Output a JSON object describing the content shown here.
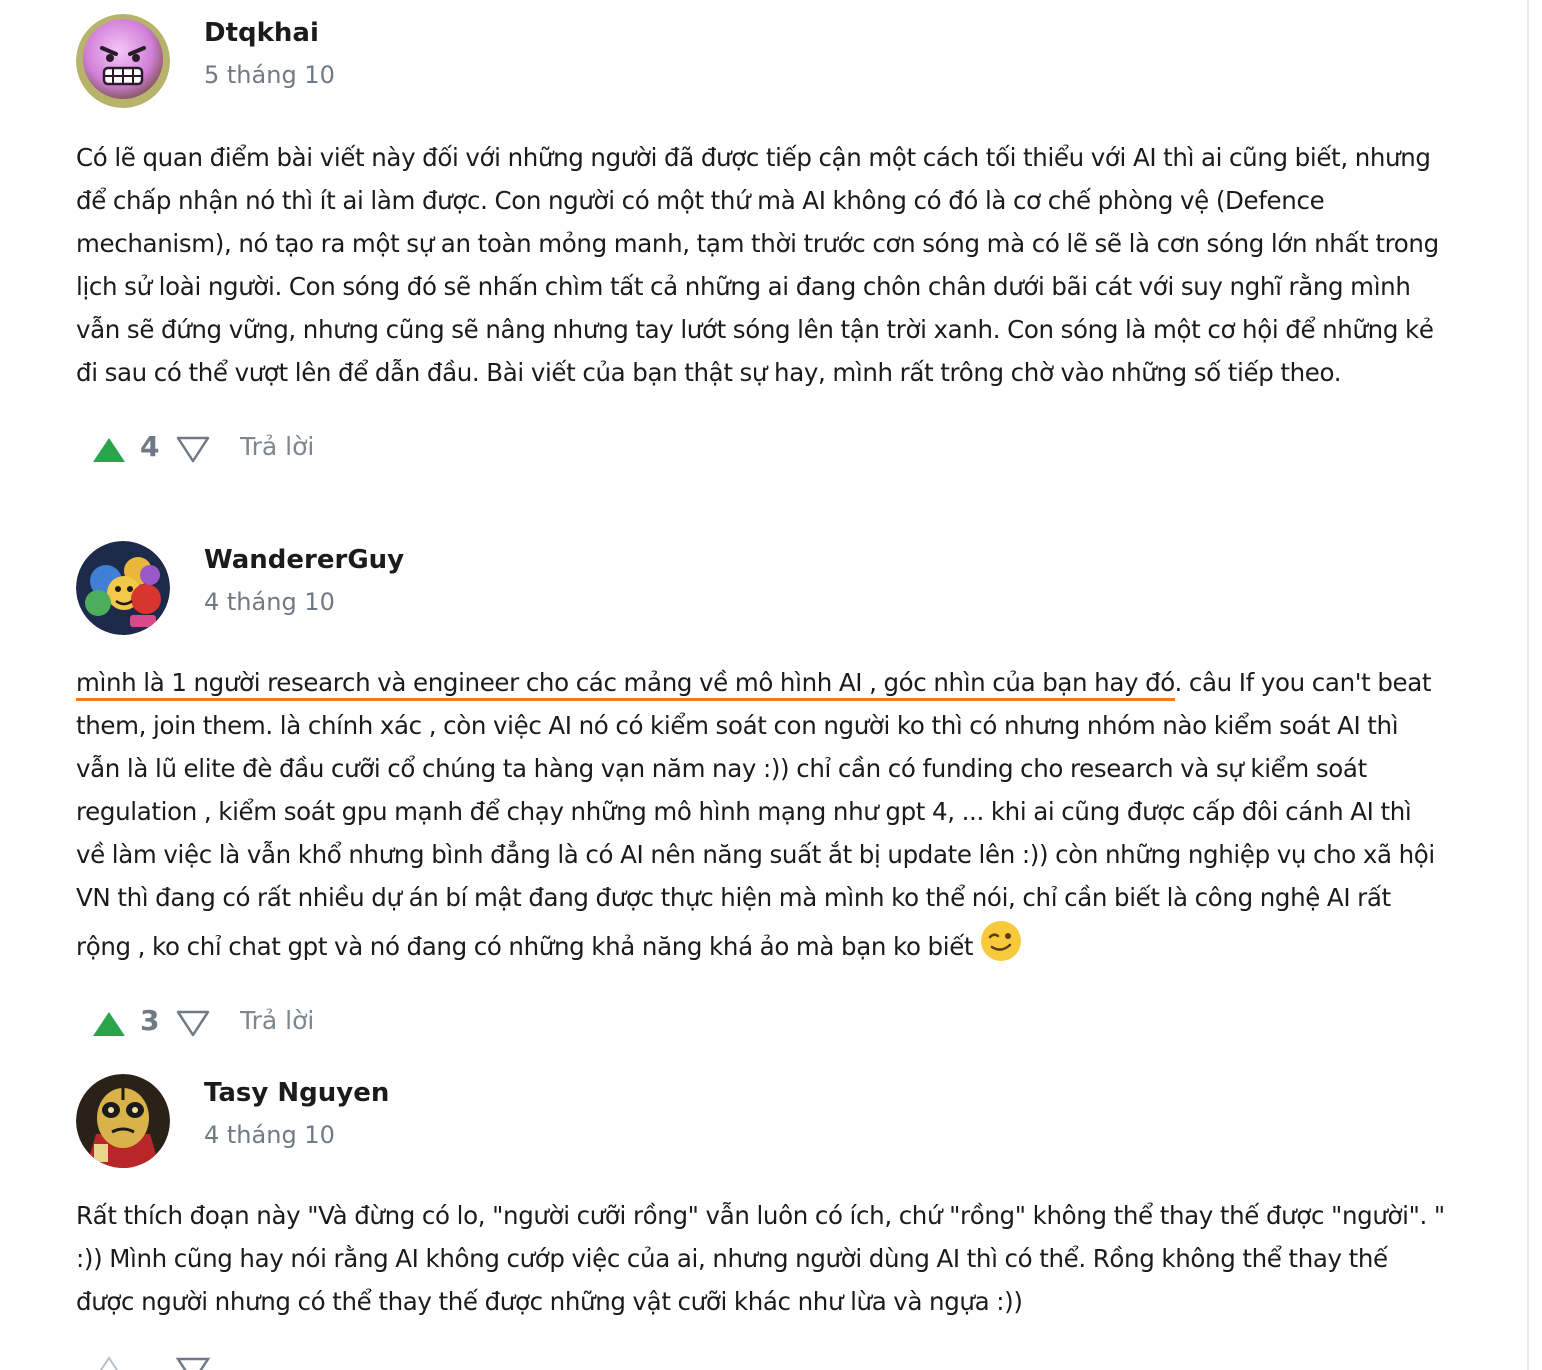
{
  "comments": [
    {
      "author": "Dtqkhai",
      "date": "5 tháng 10",
      "avatar_icon": "angry-face-avatar",
      "text": "Có lẽ quan điểm bài viết này đối với những người đã được tiếp cận một cách tối thiểu với AI thì ai cũng biết, nhưng để chấp nhận nó thì ít ai làm được. Con người có một thứ mà AI không có đó là cơ chế phòng vệ (Defence mechanism), nó tạo ra một sự an toàn mỏng manh, tạm thời trước cơn sóng mà có lẽ sẽ là cơn sóng lớn nhất trong lịch sử loài người. Con sóng đó sẽ nhấn chìm tất cả những ai đang chôn chân dưới bãi cát với suy nghĩ rằng mình vẫn sẽ đứng vững, nhưng cũng sẽ nâng nhưng tay lướt sóng lên tận trời xanh. Con sóng là một cơ hội để những kẻ đi sau có thể vượt lên để dẫn đầu. Bài viết của bạn thật sự hay, mình rất trông chờ vào những số tiếp theo.",
      "votes": "4",
      "reply_label": "Trả lời"
    },
    {
      "author": "WandererGuy",
      "date": "4 tháng 10",
      "avatar_icon": "cartoon-characters-avatar",
      "text_highlight": "mình là 1 người research và engineer cho các mảng về mô hình AI , góc nhìn của bạn hay đó",
      "text_rest": ". câu If you can't beat them, join them. là chính xác , còn việc AI nó có kiểm soát con người ko thì có nhưng nhóm nào kiểm soát AI thì vẫn là lũ elite đè đầu cưỡi cổ chúng ta hàng vạn năm nay :)) chỉ cần có funding cho research và sự kiểm soát regulation , kiểm soát gpu mạnh để chạy những mô hình mạng như gpt 4, ... khi ai cũng được cấp đôi cánh AI thì về làm việc là vẫn khổ nhưng bình đẳng là có AI nên năng suất ắt bị update lên :)) còn những nghiệp vụ cho xã hội VN thì đang có rất nhiều dự án bí mật đang được thực hiện mà mình ko thể nói, chỉ cần biết là công nghệ AI rất rộng , ko chỉ chat gpt và nó đang có những khả năng khá ảo mà bạn ko biết",
      "emoji": "winking-face-emoji",
      "votes": "3",
      "reply_label": "Trả lời"
    },
    {
      "author": "Tasy Nguyen",
      "date": "4 tháng 10",
      "avatar_icon": "masked-character-avatar",
      "text": "Rất thích đoạn này \"Và đừng có lo, \"người cưỡi rồng\" vẫn luôn có ích, chứ \"rồng\" không thể thay thế được \"người\". \" :)) Mình cũng hay nói rằng AI không cướp việc của ai, nhưng người dùng AI thì có thể. Rồng không thể thay thế được người nhưng có thể thay thế được những vật cưỡi khác như lừa và ngựa :))"
    }
  ],
  "colors": {
    "upvote": "#2aa34a",
    "highlight_underline": "#f27a1a",
    "muted": "#6f7a86"
  }
}
